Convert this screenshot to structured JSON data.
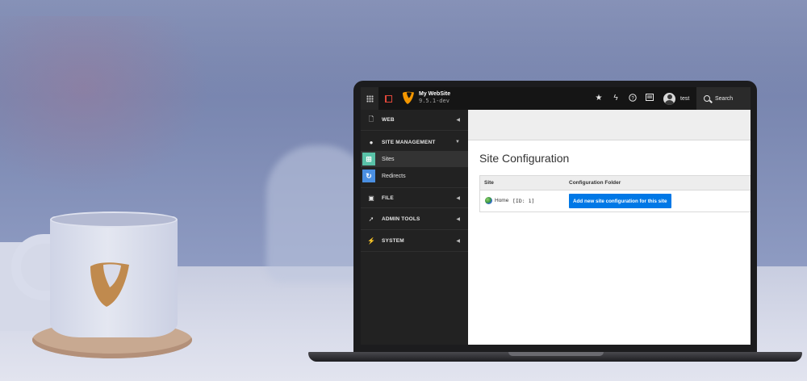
{
  "header": {
    "site_name": "My WebSite",
    "site_version": "9.5.1-dev",
    "user_name": "test",
    "search_label": "Search"
  },
  "sidebar": {
    "groups": [
      {
        "label": "WEB",
        "icon": "page-icon",
        "caret": "◀"
      },
      {
        "label": "SITE MANAGEMENT",
        "icon": "globe-icon",
        "caret": "▼"
      },
      {
        "label": "FILE",
        "icon": "image-icon",
        "caret": "◀"
      },
      {
        "label": "ADMIN TOOLS",
        "icon": "rocket-icon",
        "caret": "◀"
      },
      {
        "label": "SYSTEM",
        "icon": "plug-icon",
        "caret": "◀"
      }
    ],
    "site_management_items": [
      {
        "label": "Sites",
        "icon": "sites-icon",
        "color": "#59c2a8",
        "active": true
      },
      {
        "label": "Redirects",
        "icon": "redirect-icon",
        "color": "#4a8fe2",
        "active": false
      }
    ]
  },
  "main": {
    "title": "Site Configuration",
    "table": {
      "columns": [
        "Site",
        "Configuration Folder"
      ],
      "rows": [
        {
          "site": "Home",
          "site_id": "[ID: 1]",
          "action": "Add new site configuration for this site"
        }
      ]
    }
  },
  "colors": {
    "accent_blue": "#0078e6",
    "topbar": "#151515",
    "sidebar": "#222222",
    "typo3_orange": "#f49700"
  }
}
